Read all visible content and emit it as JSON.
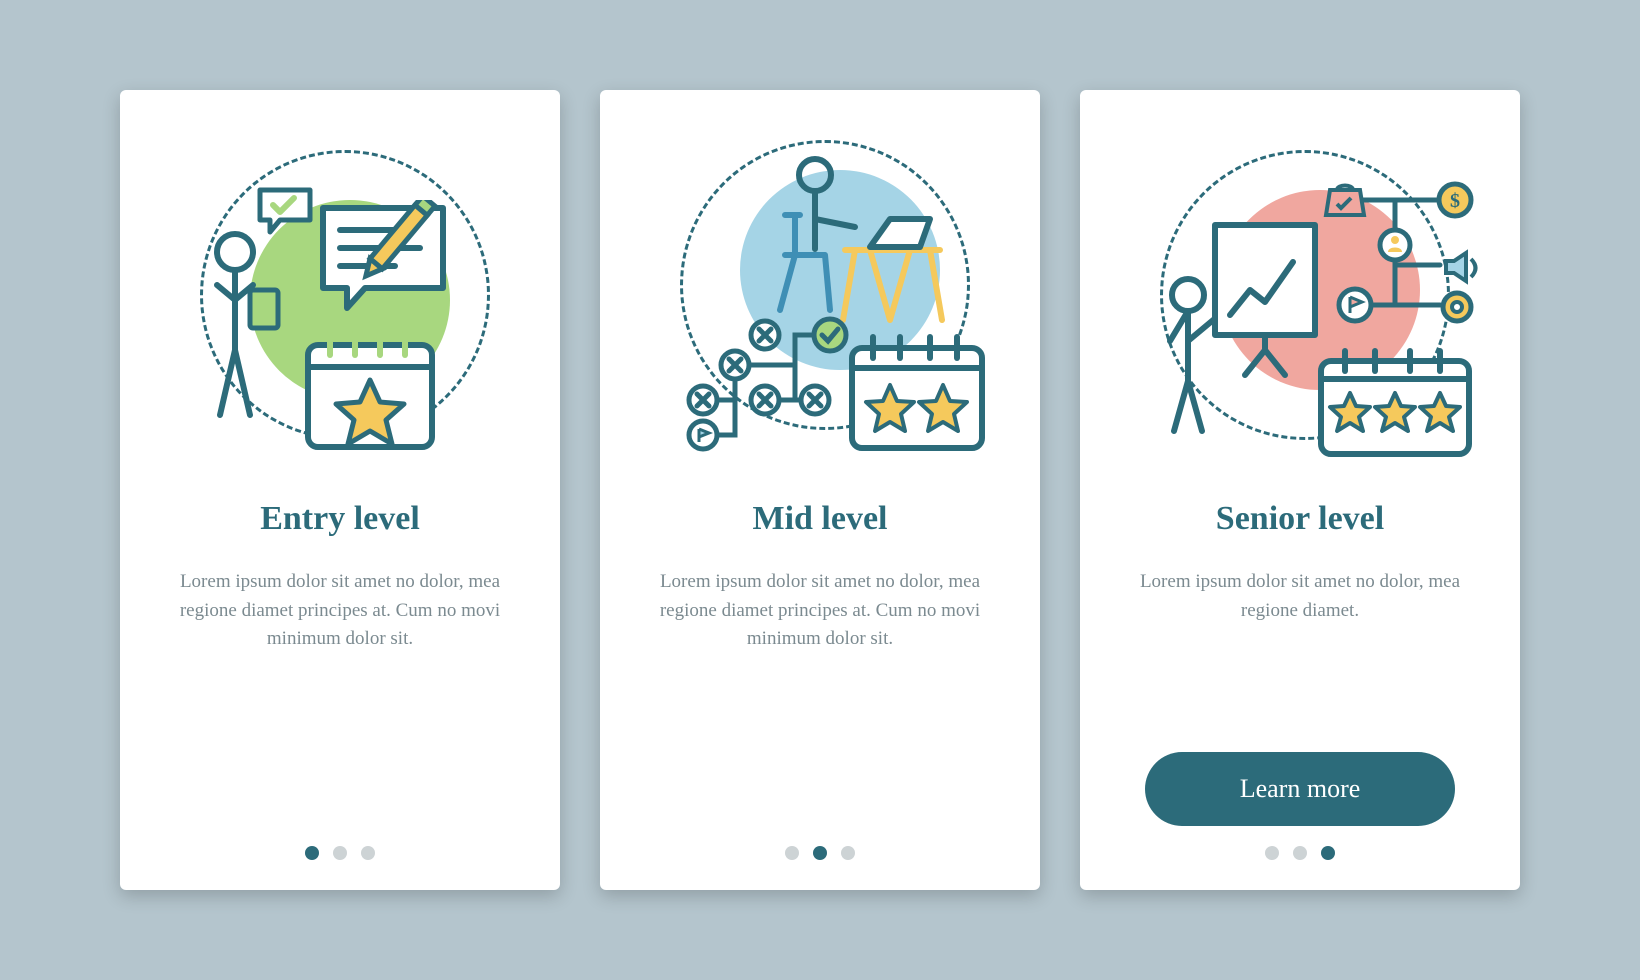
{
  "cards": [
    {
      "title": "Entry level",
      "desc": "Lorem ipsum dolor sit amet no dolor, mea regione diamet principes at. Cum no movi minimum dolor sit.",
      "activeDot": 0,
      "hasButton": false
    },
    {
      "title": "Mid level",
      "desc": "Lorem ipsum dolor sit amet no dolor, mea regione diamet principes at. Cum no movi minimum dolor sit.",
      "activeDot": 1,
      "hasButton": false
    },
    {
      "title": "Senior level",
      "desc": "Lorem ipsum dolor sit amet no dolor, mea regione diamet.",
      "activeDot": 2,
      "hasButton": true
    }
  ],
  "button": {
    "label": "Learn more"
  },
  "colors": {
    "teal": "#2c6b7a",
    "green": "#a8d77f",
    "blue": "#a5d4e6",
    "pink": "#f0a79f",
    "yellow": "#f5c95c",
    "grey": "#cdd3d5"
  }
}
